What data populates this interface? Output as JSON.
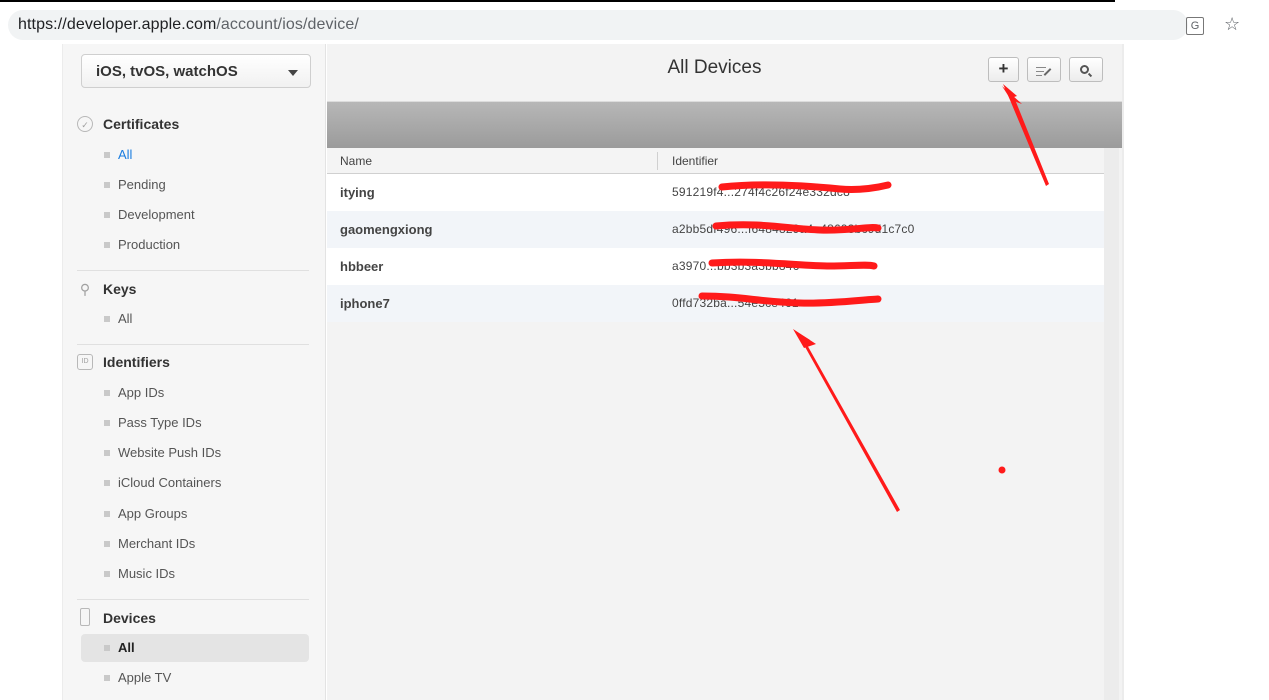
{
  "browser": {
    "url_host": "https://developer.apple.com",
    "url_path": "/account/ios/device/",
    "translate_icon": "translate-icon",
    "star_icon": "star-icon"
  },
  "sidebar": {
    "platform": "iOS, tvOS, watchOS",
    "sections": {
      "certificates": {
        "title": "Certificates",
        "items": [
          "All",
          "Pending",
          "Development",
          "Production"
        ]
      },
      "keys": {
        "title": "Keys",
        "items": [
          "All"
        ]
      },
      "identifiers": {
        "title": "Identifiers",
        "items": [
          "App IDs",
          "Pass Type IDs",
          "Website Push IDs",
          "iCloud Containers",
          "App Groups",
          "Merchant IDs",
          "Music IDs"
        ]
      },
      "devices": {
        "title": "Devices",
        "items": [
          "All",
          "Apple TV"
        ]
      }
    },
    "identifiers_icon_text": "ID"
  },
  "main": {
    "title": "All Devices",
    "add_label": "+",
    "columns": {
      "name": "Name",
      "identifier": "Identifier"
    },
    "devices": [
      {
        "name": "itying",
        "identifier": "591219f4...274f4c26f24e332dc8"
      },
      {
        "name": "gaomengxiong",
        "identifier": "a2bb5df496...f6484829a4a48693bc9d1c7c0"
      },
      {
        "name": "hbbeer",
        "identifier": "a3970...bb3b3a3bb846"
      },
      {
        "name": "iphone7",
        "identifier": "0ffd732ba...54e5ce461"
      }
    ]
  },
  "colors": {
    "annotation": "#ff1a1a",
    "link_selected": "#1b7de0"
  }
}
